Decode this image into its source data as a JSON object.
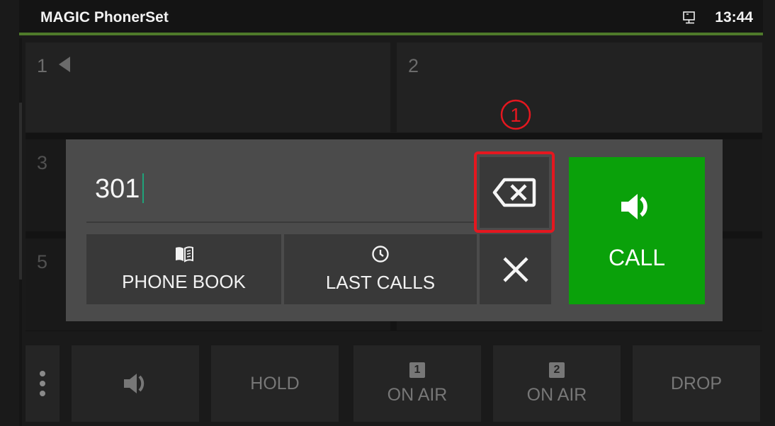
{
  "status_bar": {
    "app_title": "MAGIC PhonerSet",
    "time": "13:44",
    "network_icon": "monitor-network-icon"
  },
  "lines": [
    {
      "label": "1",
      "active_indicator": "triangle-left-icon"
    },
    {
      "label": "2"
    },
    {
      "label": "3"
    },
    {
      "label": "5"
    }
  ],
  "dial_dialog": {
    "number_value": "301",
    "backspace_icon": "backspace-icon",
    "phone_book_label": "PHONE BOOK",
    "phone_book_icon": "book-icon",
    "last_calls_label": "LAST CALLS",
    "last_calls_icon": "clock-icon",
    "close_icon": "close-icon",
    "call_label": "CALL",
    "call_icon": "speaker-icon"
  },
  "annotation": {
    "step_number": "1",
    "highlight_color": "#e5171f"
  },
  "bottom_bar": {
    "menu_icon": "vertical-dots-icon",
    "speaker_icon": "speaker-icon",
    "hold_label": "HOLD",
    "on_air_1": {
      "line": "1",
      "label": "ON AIR"
    },
    "on_air_2": {
      "line": "2",
      "label": "ON AIR"
    },
    "drop_label": "DROP"
  },
  "colors": {
    "call_green": "#0aa10a",
    "accent_bar": "#4e7a2a",
    "caret": "#1fa37a"
  }
}
